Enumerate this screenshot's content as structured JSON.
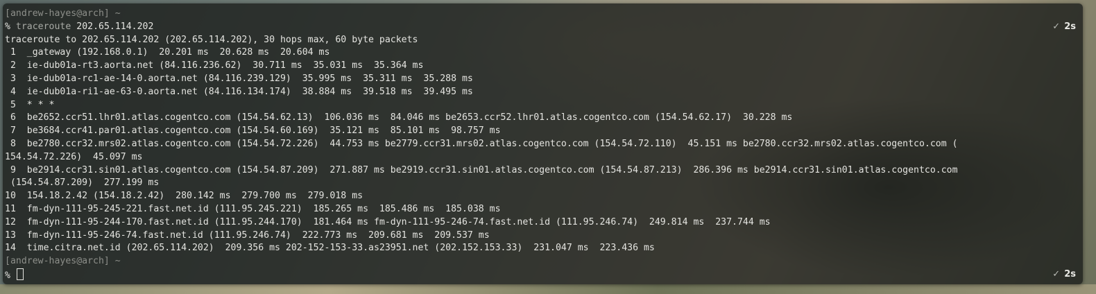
{
  "prompt1": {
    "user_host": "[andrew-hayes@arch] ~",
    "symbol": "%",
    "command": "traceroute",
    "argument": "202.65.114.202",
    "status_mark": "✓",
    "duration": "2s"
  },
  "output": [
    "traceroute to 202.65.114.202 (202.65.114.202), 30 hops max, 60 byte packets",
    " 1  _gateway (192.168.0.1)  20.201 ms  20.628 ms  20.604 ms",
    " 2  ie-dub01a-rt3.aorta.net (84.116.236.62)  30.711 ms  35.031 ms  35.364 ms",
    " 3  ie-dub01a-rc1-ae-14-0.aorta.net (84.116.239.129)  35.995 ms  35.311 ms  35.288 ms",
    " 4  ie-dub01a-ri1-ae-63-0.aorta.net (84.116.134.174)  38.884 ms  39.518 ms  39.495 ms",
    " 5  * * *",
    " 6  be2652.ccr51.lhr01.atlas.cogentco.com (154.54.62.13)  106.036 ms  84.046 ms be2653.ccr52.lhr01.atlas.cogentco.com (154.54.62.17)  30.228 ms",
    " 7  be3684.ccr41.par01.atlas.cogentco.com (154.54.60.169)  35.121 ms  85.101 ms  98.757 ms",
    " 8  be2780.ccr32.mrs02.atlas.cogentco.com (154.54.72.226)  44.753 ms be2779.ccr31.mrs02.atlas.cogentco.com (154.54.72.110)  45.151 ms be2780.ccr32.mrs02.atlas.cogentco.com (",
    "154.54.72.226)  45.097 ms",
    " 9  be2914.ccr31.sin01.atlas.cogentco.com (154.54.87.209)  271.887 ms be2919.ccr31.sin01.atlas.cogentco.com (154.54.87.213)  286.396 ms be2914.ccr31.sin01.atlas.cogentco.com",
    " (154.54.87.209)  277.199 ms",
    "10  154.18.2.42 (154.18.2.42)  280.142 ms  279.700 ms  279.018 ms",
    "11  fm-dyn-111-95-245-221.fast.net.id (111.95.245.221)  185.265 ms  185.486 ms  185.038 ms",
    "12  fm-dyn-111-95-244-170.fast.net.id (111.95.244.170)  181.464 ms fm-dyn-111-95-246-74.fast.net.id (111.95.246.74)  249.814 ms  237.744 ms",
    "13  fm-dyn-111-95-246-74.fast.net.id (111.95.246.74)  222.773 ms  209.681 ms  209.537 ms",
    "14  time.citra.net.id (202.65.114.202)  209.356 ms 202-152-153-33.as23951.net (202.152.153.33)  231.047 ms  223.436 ms"
  ],
  "prompt2": {
    "user_host": "[andrew-hayes@arch] ~",
    "symbol": "%",
    "status_mark": "✓",
    "duration": "2s"
  }
}
